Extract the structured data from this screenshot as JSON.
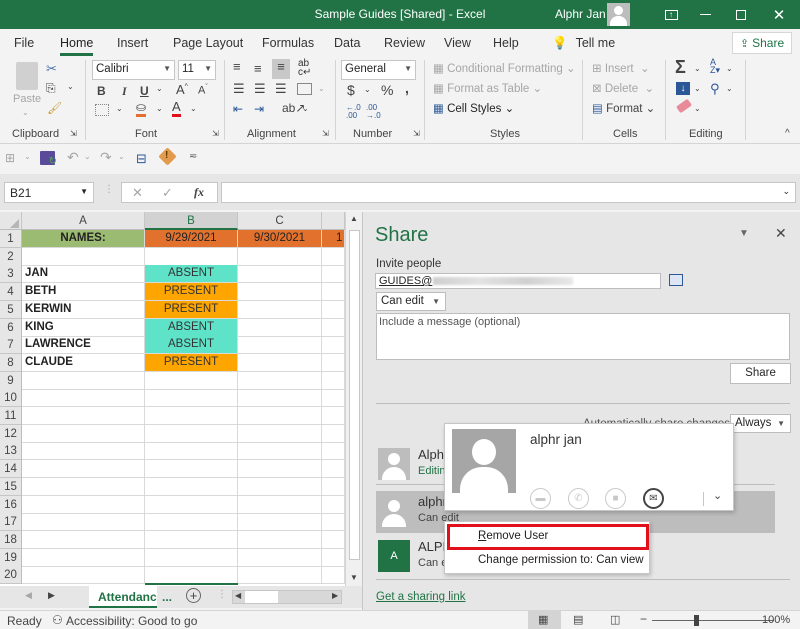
{
  "titlebar": {
    "title": "Sample Guides  [Shared]  -  Excel",
    "user": "Alphr Jan",
    "buttons": [
      "ribbon-display-options",
      "minimize",
      "maximize",
      "close"
    ]
  },
  "menu": {
    "tabs": [
      "File",
      "Home",
      "Insert",
      "Page Layout",
      "Formulas",
      "Data",
      "Review",
      "View",
      "Help"
    ],
    "active_tab": "Home",
    "tell_me": "Tell me",
    "share": "Share"
  },
  "ribbon": {
    "clipboard": {
      "label": "Clipboard",
      "paste": "Paste"
    },
    "font": {
      "label": "Font",
      "family": "Calibri",
      "size": "11",
      "bold": "B",
      "italic": "I",
      "underline": "U"
    },
    "alignment": {
      "label": "Alignment"
    },
    "number": {
      "label": "Number",
      "format": "General",
      "currency": "$",
      "percent": "%",
      "comma": ","
    },
    "styles": {
      "label": "Styles",
      "conditional": "Conditional Formatting",
      "format_table": "Format as Table",
      "cell_styles": "Cell Styles"
    },
    "cells": {
      "label": "Cells",
      "insert": "Insert",
      "delete": "Delete",
      "format": "Format"
    },
    "editing": {
      "label": "Editing",
      "sum": "Σ"
    }
  },
  "formula_bar": {
    "name_box": "B21",
    "cancel": "✕",
    "enter": "✓",
    "fx": "fx",
    "value": ""
  },
  "sheet": {
    "columns": [
      "A",
      "B",
      "C"
    ],
    "selected_column": "B",
    "header_row": {
      "a": "NAMES:",
      "b": "9/29/2021",
      "c": "9/30/2021",
      "d": "1"
    },
    "rows": [
      {
        "num": "1"
      },
      {
        "num": "2",
        "name": "",
        "status": ""
      },
      {
        "num": "3",
        "name": "JAN",
        "status": "ABSENT"
      },
      {
        "num": "4",
        "name": "BETH",
        "status": "PRESENT"
      },
      {
        "num": "5",
        "name": "KERWIN",
        "status": "PRESENT"
      },
      {
        "num": "6",
        "name": "KING",
        "status": "ABSENT"
      },
      {
        "num": "7",
        "name": "LAWRENCE",
        "status": "ABSENT"
      },
      {
        "num": "8",
        "name": "CLAUDE",
        "status": "PRESENT"
      }
    ],
    "empty_rows": [
      "9",
      "10",
      "11",
      "12",
      "13",
      "14",
      "15",
      "16",
      "17",
      "18",
      "19",
      "20"
    ],
    "colors": {
      "names_header": "#9bbb72",
      "date_header": "#e2712d",
      "absent": "#5fe3c8",
      "present": "#ffa500"
    },
    "active_tab": "Attendanc",
    "tab_more": "..."
  },
  "status": {
    "ready": "Ready",
    "accessibility": "Accessibility: Good to go",
    "zoom_text": "100%"
  },
  "share_pane": {
    "title": "Share",
    "invite_label": "Invite people",
    "invite_value": "GUIDES@",
    "permission": "Can edit",
    "message_placeholder": "Include a message (optional)",
    "share_button": "Share",
    "auto_share_label": "Automatically share changes:",
    "auto_share_value": "Always",
    "people": [
      {
        "name": "Alphr Jan",
        "role": "Editing"
      },
      {
        "name": "alphr jan",
        "role": "Can edit"
      },
      {
        "name": "ALPHR",
        "role": "Can edit",
        "initial": "A"
      }
    ],
    "get_link": "Get a sharing link"
  },
  "contact_card": {
    "name": "alphr jan",
    "actions": [
      "im",
      "call",
      "video",
      "email"
    ]
  },
  "context_menu": {
    "items": [
      {
        "label": "Remove User",
        "accel": "R",
        "highlighted": true
      },
      {
        "label": "Change permission to: Can view",
        "accel": "v"
      }
    ]
  }
}
